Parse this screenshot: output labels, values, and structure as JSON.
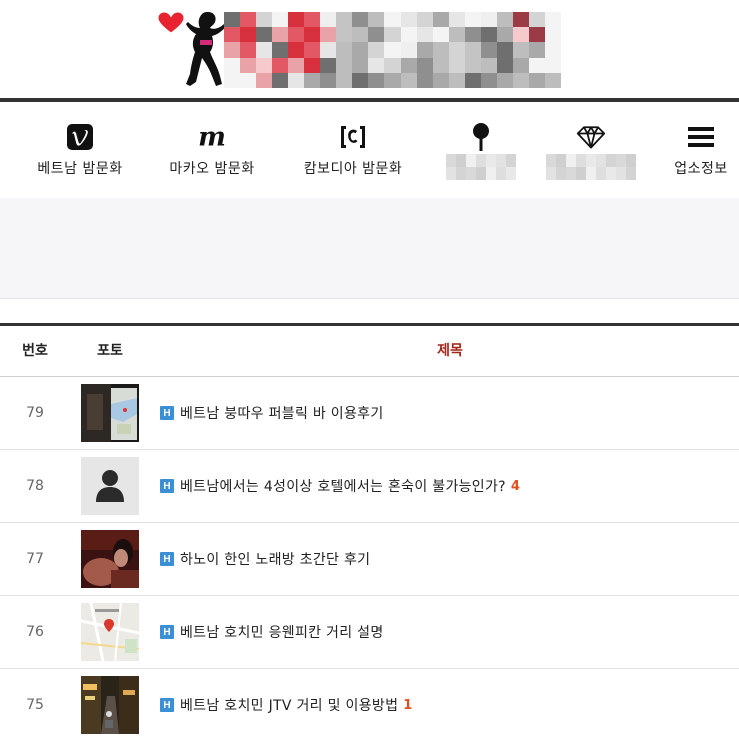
{
  "logo": {
    "heart_color": "#e8232f"
  },
  "nav": {
    "items": [
      {
        "label": "베트남 밤문화",
        "icon": "vimeo-v-icon"
      },
      {
        "label": "마카오 밤문화",
        "icon": "m-letter-icon"
      },
      {
        "label": "캄보디아 밤문화",
        "icon": "bracket-c-icon"
      },
      {
        "label": "",
        "icon": "map-pin-icon"
      },
      {
        "label": "",
        "icon": "diamond-icon"
      },
      {
        "label": "업소정보",
        "icon": "menu-bars-icon"
      }
    ]
  },
  "table": {
    "headers": {
      "num": "번호",
      "photo": "포토",
      "title": "제목"
    },
    "rows": [
      {
        "num": "79",
        "title": "베트남 붕따우 퍼블릭 바 이용후기",
        "comments": "",
        "thumb": "photo-map-night"
      },
      {
        "num": "78",
        "title": "베트남에서는 4성이상 호텔에서는 혼숙이 불가능인가?",
        "comments": "4",
        "thumb": "default-avatar"
      },
      {
        "num": "77",
        "title": "하노이 한인 노래방 초간단 후기",
        "comments": "",
        "thumb": "photo-dark-portrait"
      },
      {
        "num": "76",
        "title": "베트남 호치민 응웬피칸 거리 설명",
        "comments": "",
        "thumb": "photo-street-map"
      },
      {
        "num": "75",
        "title": "베트남 호치민 JTV 거리 및 이용방법",
        "comments": "1",
        "thumb": "photo-street-night"
      }
    ],
    "badge": "H",
    "accent_color": "#3a8fd6",
    "comment_color": "#e0501e"
  }
}
